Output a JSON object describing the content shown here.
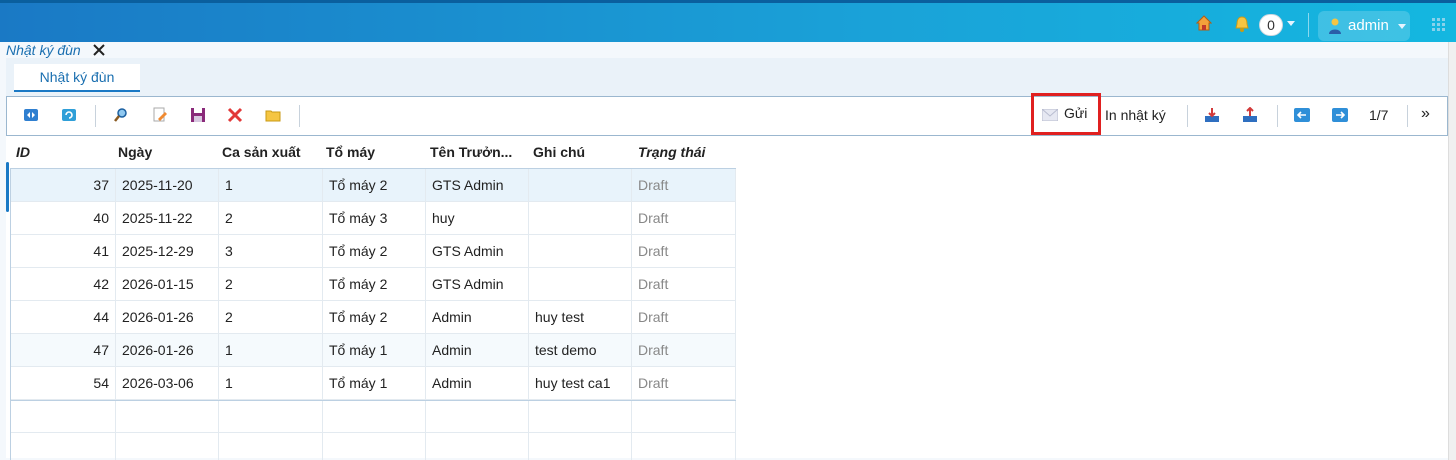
{
  "header": {
    "notifications_count": "0",
    "user_name": "admin",
    "icons": [
      "home-icon",
      "bell-icon",
      "user-icon",
      "apps-grid-icon"
    ]
  },
  "window_tab": {
    "label": "Nhật ký đùn",
    "close_icon": "close-icon"
  },
  "inner_tab": {
    "label": "Nhật ký đùn"
  },
  "toolbar": {
    "left_icons": [
      "toggle-width-icon",
      "refresh-icon",
      "search-icon",
      "edit-icon",
      "save-icon",
      "delete-icon",
      "folder-icon"
    ],
    "send_label": "Gửi",
    "print_label": "In nhật ký",
    "pagination": "1/7",
    "more_label": "»",
    "accent": "#e02020"
  },
  "table": {
    "columns": [
      "ID",
      "Ngày",
      "Ca sản xuất",
      "Tổ máy",
      "Tên Trưởn...",
      "Ghi chú",
      "Trạng thái"
    ],
    "rows": [
      {
        "id": "37",
        "date": "2025-11-20",
        "ca": "1",
        "to": "Tổ máy 2",
        "ten": "GTS Admin",
        "gc": "",
        "tt": "Draft"
      },
      {
        "id": "40",
        "date": "2025-11-22",
        "ca": "2",
        "to": "Tổ máy 3",
        "ten": "huy",
        "gc": "",
        "tt": "Draft"
      },
      {
        "id": "41",
        "date": "2025-12-29",
        "ca": "3",
        "to": "Tổ máy 2",
        "ten": "GTS Admin",
        "gc": "",
        "tt": "Draft"
      },
      {
        "id": "42",
        "date": "2026-01-15",
        "ca": "2",
        "to": "Tổ máy 2",
        "ten": "GTS Admin",
        "gc": "",
        "tt": "Draft"
      },
      {
        "id": "44",
        "date": "2026-01-26",
        "ca": "2",
        "to": "Tổ máy 2",
        "ten": "Admin",
        "gc": "huy test",
        "tt": "Draft"
      },
      {
        "id": "47",
        "date": "2026-01-26",
        "ca": "1",
        "to": "Tổ máy 1",
        "ten": "Admin",
        "gc": "test demo",
        "tt": "Draft"
      },
      {
        "id": "54",
        "date": "2026-03-06",
        "ca": "1",
        "to": "Tổ máy 1",
        "ten": "Admin",
        "gc": "huy test ca1",
        "tt": "Draft"
      }
    ]
  },
  "colors": {
    "header_start": "#1a79c5",
    "header_end": "#14b7e0",
    "link": "#1a6fb0"
  }
}
